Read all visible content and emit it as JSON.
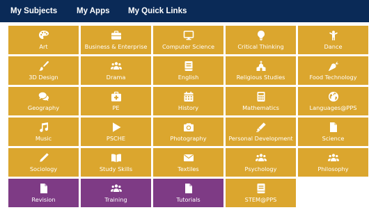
{
  "nav": {
    "items": [
      {
        "label": "My Subjects"
      },
      {
        "label": "My Apps"
      },
      {
        "label": "My Quick Links"
      }
    ]
  },
  "colors": {
    "topbar": "#0a2a57",
    "tile_gold": "#dba62e",
    "tile_purple": "#7e3b85",
    "text": "#ffffff"
  },
  "tiles": [
    {
      "label": "Art",
      "icon": "palette-icon",
      "color": "gold"
    },
    {
      "label": "Business & Enterprise",
      "icon": "briefcase-icon",
      "color": "gold"
    },
    {
      "label": "Computer Science",
      "icon": "monitor-icon",
      "color": "gold"
    },
    {
      "label": "Critical Thinking",
      "icon": "lightbulb-icon",
      "color": "gold"
    },
    {
      "label": "Dance",
      "icon": "person-icon",
      "color": "gold"
    },
    {
      "label": "3D Design",
      "icon": "paintbrush-icon",
      "color": "gold"
    },
    {
      "label": "Drama",
      "icon": "users-icon",
      "color": "gold"
    },
    {
      "label": "English",
      "icon": "book-icon",
      "color": "gold"
    },
    {
      "label": "Religious Studies",
      "icon": "church-icon",
      "color": "gold"
    },
    {
      "label": "Food Technology",
      "icon": "carrot-icon",
      "color": "gold"
    },
    {
      "label": "Geography",
      "icon": "comments-icon",
      "color": "gold"
    },
    {
      "label": "PE",
      "icon": "medkit-icon",
      "color": "gold"
    },
    {
      "label": "History",
      "icon": "calendar-icon",
      "color": "gold"
    },
    {
      "label": "Mathematics",
      "icon": "calculator-icon",
      "color": "gold"
    },
    {
      "label": "Languages@PPS",
      "icon": "globe-icon",
      "color": "gold"
    },
    {
      "label": "Music",
      "icon": "music-icon",
      "color": "gold"
    },
    {
      "label": "PSCHE",
      "icon": "play-icon",
      "color": "gold"
    },
    {
      "label": "Photography",
      "icon": "camera-icon",
      "color": "gold"
    },
    {
      "label": "Personal Development",
      "icon": "marker-icon",
      "color": "gold"
    },
    {
      "label": "Science",
      "icon": "file-icon",
      "color": "gold"
    },
    {
      "label": "Sociology",
      "icon": "pencil-icon",
      "color": "gold"
    },
    {
      "label": "Study Skills",
      "icon": "open-book-icon",
      "color": "gold"
    },
    {
      "label": "Textiles",
      "icon": "envelope-icon",
      "color": "gold"
    },
    {
      "label": "Psychology",
      "icon": "users-icon",
      "color": "gold"
    },
    {
      "label": "Philosophy",
      "icon": "users-icon",
      "color": "gold"
    },
    {
      "label": "Revision",
      "icon": "file-icon",
      "color": "purple"
    },
    {
      "label": "Training",
      "icon": "users-icon",
      "color": "purple"
    },
    {
      "label": "Tutorials",
      "icon": "file-icon",
      "color": "purple"
    },
    {
      "label": "STEM@PPS",
      "icon": "book-icon",
      "color": "gold"
    }
  ]
}
